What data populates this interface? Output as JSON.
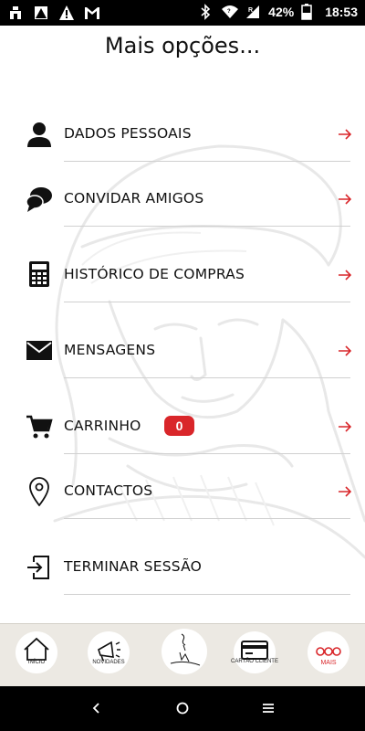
{
  "status_bar": {
    "battery_percent": "42%",
    "time": "18:53",
    "icons": [
      "home-notification-icon",
      "warning-triangle-icon",
      "alert-icon",
      "gmail-icon",
      "bluetooth-icon",
      "wifi-icon",
      "signal-icon",
      "battery-icon"
    ]
  },
  "page": {
    "title": "Mais opções..."
  },
  "menu": {
    "items": [
      {
        "label": "DADOS PESSOAIS",
        "icon": "person-icon"
      },
      {
        "label": "CONVIDAR AMIGOS",
        "icon": "chat-bubbles-icon"
      },
      {
        "label": "HISTÓRICO DE COMPRAS",
        "icon": "calculator-icon"
      },
      {
        "label": "MENSAGENS",
        "icon": "envelope-icon"
      },
      {
        "label": "CARRINHO",
        "icon": "cart-icon",
        "badge": "0"
      },
      {
        "label": "CONTACTOS",
        "icon": "location-pin-icon"
      },
      {
        "label": "TERMINAR SESSÃO",
        "icon": "logout-icon"
      }
    ]
  },
  "tabs": {
    "items": [
      {
        "label": "INÍCIO",
        "icon": "home-icon"
      },
      {
        "label": "NOVIDADES",
        "icon": "megaphone-icon"
      },
      {
        "label": "",
        "icon": "brand-logo-icon"
      },
      {
        "label": "CARTÃO CLIENTE",
        "icon": "card-icon"
      },
      {
        "label": "MAIS",
        "icon": "more-dots-icon"
      }
    ]
  },
  "colors": {
    "accent": "#d9262a",
    "tab_bar_bg": "#ece9e3",
    "text": "#111111"
  }
}
